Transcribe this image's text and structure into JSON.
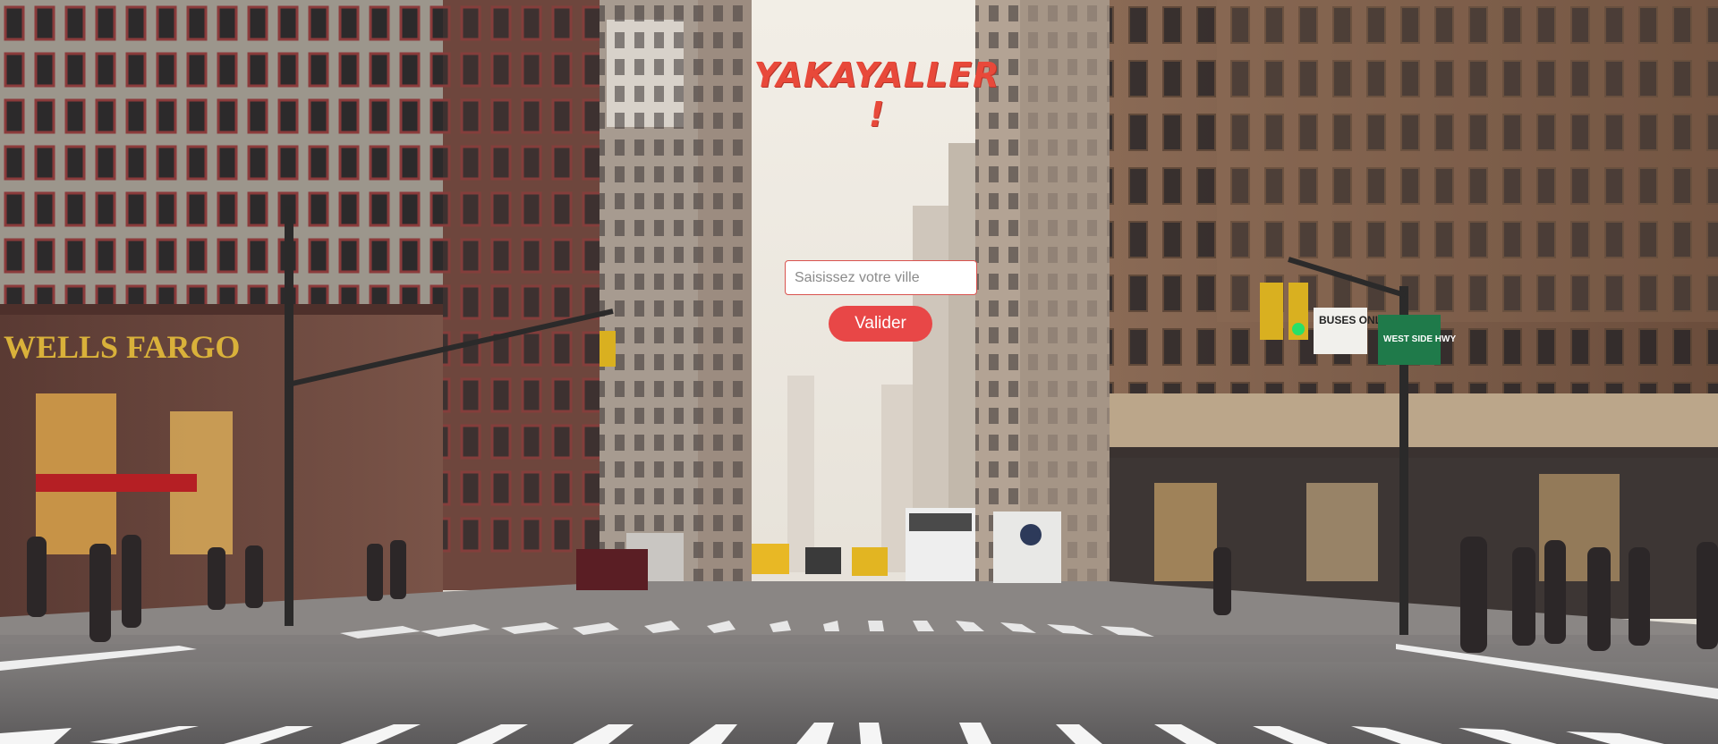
{
  "app": {
    "title": "YAKAYALLER !"
  },
  "search": {
    "placeholder": "Saisissez votre ville",
    "value": ""
  },
  "actions": {
    "submit_label": "Valider"
  },
  "background": {
    "sign_wells_fargo": "WELLS FARGO",
    "sign_buses_only": "BUSES ONLY",
    "sign_west_side": "WEST SIDE HWY"
  },
  "colors": {
    "accent": "#e84747",
    "title": "#e8493a"
  }
}
